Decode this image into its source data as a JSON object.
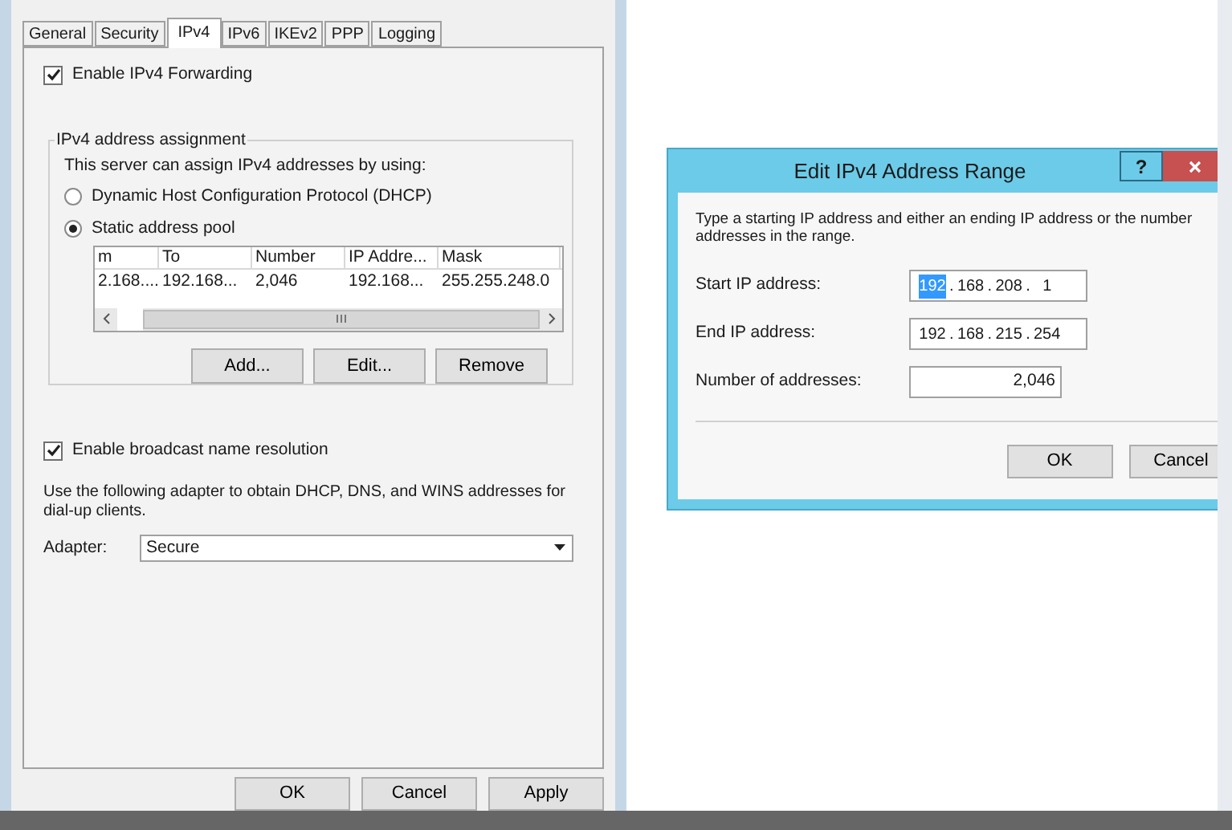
{
  "properties_dialog": {
    "tabs": [
      {
        "label": "General",
        "selected": false
      },
      {
        "label": "Security",
        "selected": false
      },
      {
        "label": "IPv4",
        "selected": true
      },
      {
        "label": "IPv6",
        "selected": false
      },
      {
        "label": "IKEv2",
        "selected": false
      },
      {
        "label": "PPP",
        "selected": false
      },
      {
        "label": "Logging",
        "selected": false
      }
    ],
    "ipv4_forwarding": {
      "label": "Enable IPv4 Forwarding",
      "checked": true
    },
    "assignment_group": {
      "title": "IPv4 address assignment",
      "description": "This server can assign IPv4 addresses by using:",
      "options": [
        {
          "label": "Dynamic Host Configuration Protocol (DHCP)",
          "selected": false
        },
        {
          "label": "Static address pool",
          "selected": true
        }
      ],
      "table": {
        "columns": [
          "m",
          "To",
          "Number",
          "IP Addre...",
          "Mask"
        ],
        "rows": [
          [
            "2.168....",
            "192.168...",
            "2,046",
            "192.168...",
            "255.255.248.0"
          ]
        ]
      },
      "buttons": [
        "Add...",
        "Edit...",
        "Remove"
      ]
    },
    "broadcast": {
      "label": "Enable broadcast name resolution",
      "checked": true
    },
    "adapter_note": "Use the following adapter to obtain DHCP, DNS, and WINS addresses for dial-up clients.",
    "adapter": {
      "label": "Adapter:",
      "value": "Secure"
    },
    "buttons": [
      "OK",
      "Cancel",
      "Apply"
    ]
  },
  "edit_dialog": {
    "title": "Edit IPv4 Address Range",
    "help": "?",
    "instructions": [
      "Type a starting IP address and either an ending IP address or the number",
      "addresses in the range."
    ],
    "fields": [
      {
        "kind": "ip",
        "label": "Start IP address:",
        "separator": ".",
        "octets": [
          {
            "text": "192",
            "selected": true
          },
          {
            "text": "168",
            "selected": false
          },
          {
            "text": "208",
            "selected": false
          },
          {
            "text": "1",
            "selected": false
          }
        ]
      },
      {
        "kind": "ip",
        "label": "End IP address:",
        "separator": ".",
        "octets": [
          {
            "text": "192",
            "selected": false
          },
          {
            "text": "168",
            "selected": false
          },
          {
            "text": "215",
            "selected": false
          },
          {
            "text": "254",
            "selected": false
          }
        ]
      },
      {
        "kind": "number",
        "label": "Number of addresses:",
        "value": "2,046"
      }
    ],
    "buttons": [
      "OK",
      "Cancel"
    ]
  }
}
